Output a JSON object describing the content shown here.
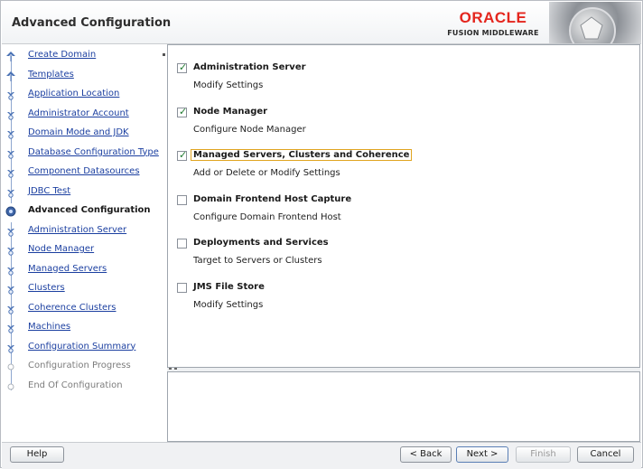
{
  "header": {
    "title": "Advanced Configuration",
    "brand_name": "ORACLE",
    "brand_subtitle": "FUSION MIDDLEWARE",
    "brand_color": "#e4261e"
  },
  "sidebar": {
    "steps": [
      {
        "label": "Create Domain",
        "state": "done",
        "icon": "completed-step-icon"
      },
      {
        "label": "Templates",
        "state": "done",
        "icon": "completed-step-icon"
      },
      {
        "label": "Application Location",
        "state": "done",
        "icon": "step-icon"
      },
      {
        "label": "Administrator Account",
        "state": "done",
        "icon": "step-icon"
      },
      {
        "label": "Domain Mode and JDK",
        "state": "done",
        "icon": "step-icon"
      },
      {
        "label": "Database Configuration Type",
        "state": "done",
        "icon": "step-icon"
      },
      {
        "label": "Component Datasources",
        "state": "done",
        "icon": "step-icon"
      },
      {
        "label": "JDBC Test",
        "state": "done",
        "icon": "step-icon"
      },
      {
        "label": "Advanced Configuration",
        "state": "current",
        "icon": "current-step-icon"
      },
      {
        "label": "Administration Server",
        "state": "pending",
        "icon": "step-icon"
      },
      {
        "label": "Node Manager",
        "state": "pending",
        "icon": "step-icon"
      },
      {
        "label": "Managed Servers",
        "state": "pending",
        "icon": "step-icon"
      },
      {
        "label": "Clusters",
        "state": "pending",
        "icon": "step-icon"
      },
      {
        "label": "Coherence Clusters",
        "state": "pending",
        "icon": "step-icon"
      },
      {
        "label": "Machines",
        "state": "pending",
        "icon": "step-icon"
      },
      {
        "label": "Configuration Summary",
        "state": "pending",
        "icon": "step-icon"
      },
      {
        "label": "Configuration Progress",
        "state": "future",
        "icon": "step-icon"
      },
      {
        "label": "End Of Configuration",
        "state": "future",
        "icon": "step-icon"
      }
    ]
  },
  "options": [
    {
      "name": "Administration Server",
      "description": "Modify Settings",
      "checked": true
    },
    {
      "name": "Node Manager",
      "description": "Configure Node Manager",
      "checked": true
    },
    {
      "name": "Managed Servers, Clusters and Coherence",
      "description": "Add or Delete or Modify Settings",
      "checked": true
    },
    {
      "name": "Domain Frontend Host Capture",
      "description": "Configure Domain Frontend Host",
      "checked": false
    },
    {
      "name": "Deployments and Services",
      "description": "Target to Servers or Clusters",
      "checked": false
    },
    {
      "name": "JMS File Store",
      "description": "Modify Settings",
      "checked": false
    }
  ],
  "footer": {
    "help_label": "Help",
    "back_label": "< Back",
    "next_label": "Next >",
    "finish_label": "Finish",
    "cancel_label": "Cancel"
  }
}
